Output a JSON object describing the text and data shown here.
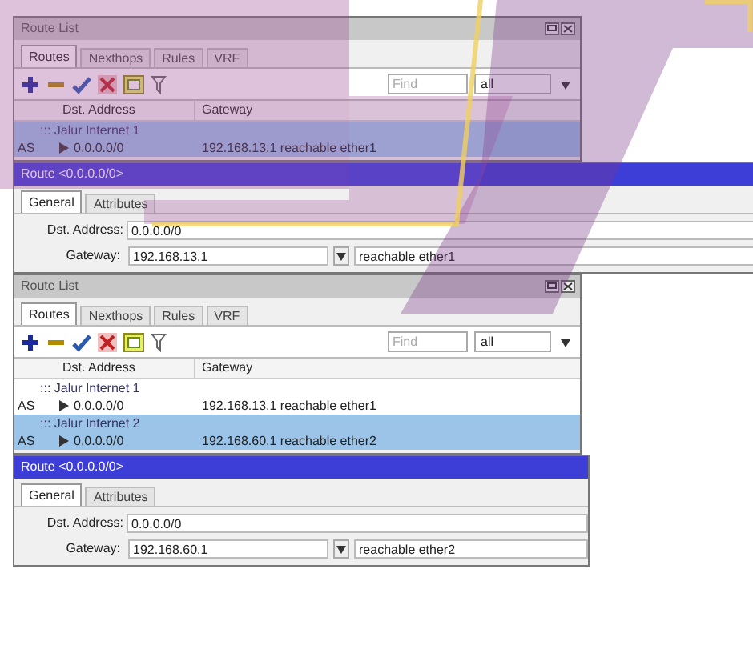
{
  "windows": [
    {
      "kind": "route_list",
      "title": "Route List",
      "tabs": [
        {
          "label": "Routes",
          "selected": true
        },
        {
          "label": "Nexthops",
          "selected": false
        },
        {
          "label": "Rules",
          "selected": false
        },
        {
          "label": "VRF",
          "selected": false
        }
      ],
      "find_placeholder": "Find",
      "filter": "all",
      "columns": [
        "Dst. Address",
        "Gateway"
      ],
      "rows": [
        {
          "kind": "group",
          "label": "::: Jalur Internet 1",
          "selected": true
        },
        {
          "kind": "route",
          "flag": "AS",
          "dst": "0.0.0.0/0",
          "gateway": "192.168.13.1 reachable ether1",
          "selected": true
        }
      ]
    },
    {
      "kind": "route_dialog",
      "title": "Route <0.0.0.0/0>",
      "tabs": [
        {
          "label": "General",
          "selected": true
        },
        {
          "label": "Attributes",
          "selected": false
        }
      ],
      "dst_label": "Dst. Address:",
      "dst_address": "0.0.0.0/0",
      "gateway_label": "Gateway:",
      "gateway": "192.168.13.1",
      "gateway_status": "reachable ether1"
    },
    {
      "kind": "route_list",
      "title": "Route List",
      "tabs": [
        {
          "label": "Routes",
          "selected": true
        },
        {
          "label": "Nexthops",
          "selected": false
        },
        {
          "label": "Rules",
          "selected": false
        },
        {
          "label": "VRF",
          "selected": false
        }
      ],
      "find_placeholder": "Find",
      "filter": "all",
      "columns": [
        "Dst. Address",
        "Gateway"
      ],
      "rows": [
        {
          "kind": "group",
          "label": "::: Jalur Internet 1",
          "selected": false
        },
        {
          "kind": "route",
          "flag": "AS",
          "dst": "0.0.0.0/0",
          "gateway": "192.168.13.1 reachable ether1",
          "selected": false
        },
        {
          "kind": "group",
          "label": "::: Jalur Internet 2",
          "selected": true
        },
        {
          "kind": "route",
          "flag": "AS",
          "dst": "0.0.0.0/0",
          "gateway": "192.168.60.1 reachable ether2",
          "selected": true
        }
      ]
    },
    {
      "kind": "route_dialog",
      "title": "Route <0.0.0.0/0>",
      "tabs": [
        {
          "label": "General",
          "selected": true
        },
        {
          "label": "Attributes",
          "selected": false
        }
      ],
      "dst_label": "Dst. Address:",
      "dst_address": "0.0.0.0/0",
      "gateway_label": "Gateway:",
      "gateway": "192.168.60.1",
      "gateway_status": "reachable ether2"
    }
  ]
}
